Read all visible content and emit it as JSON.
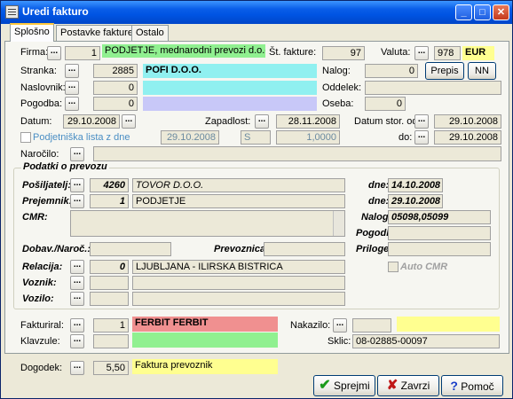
{
  "window": {
    "title": "Uredi fakturo"
  },
  "tabs": [
    "Splošno",
    "Postavke fakture",
    "Ostalo"
  ],
  "colors": {
    "green": "#90f090",
    "cyan": "#90f0f0",
    "lavender": "#c8c8f8",
    "red": "#f09090",
    "yellow": "#ffff90"
  },
  "form": {
    "firma_label": "Firma:",
    "firma_code": "1",
    "firma_name": "PODJETJE, mednarodni prevozi d.o.o.",
    "st_fakture_label": "Št. fakture:",
    "st_fakture": "97",
    "valuta_label": "Valuta:",
    "valuta_code": "978",
    "valuta_name": "EUR",
    "stranka_label": "Stranka:",
    "stranka_code": "2885",
    "stranka_name": "POFI D.O.O.",
    "naslovnik_label": "Naslovnik:",
    "naslovnik_code": "0",
    "pogodba_label": "Pogodba:",
    "pogodba_code": "0",
    "nalog_label": "Nalog:",
    "nalog": "0",
    "prepis_label": "Prepis",
    "nn_label": "NN",
    "oddelek_label": "Oddelek:",
    "oseba_label": "Oseba:",
    "oseba": "0",
    "datum_label": "Datum:",
    "datum": "29.10.2008",
    "zapadlost_label": "Zapadlost:",
    "zapadlost": "28.11.2008",
    "datum_stor_label": "Datum stor. od:",
    "datum_stor": "29.10.2008",
    "do_label": "do:",
    "do": "29.10.2008",
    "podjetniska_label": "Podjetniška lista z dne",
    "podjetniska_date": "29.10.2008",
    "podjetniska_s": "S",
    "podjetniska_rate": "1,0000",
    "narocilo_label": "Naročilo:"
  },
  "prevoz": {
    "group_title": "Podatki o prevozu",
    "posiljatelj_label": "Pošiljatelj:",
    "posiljatelj_code": "4260",
    "posiljatelj_name": "TOVOR D.O.O.",
    "prejemnik_label": "Prejemnik:",
    "prejemnik_code": "1",
    "prejemnik_name": "PODJETJE",
    "dne_label": "dne:",
    "dne1": "14.10.2008",
    "dne2": "29.10.2008",
    "cmr_label": "CMR:",
    "nalog_label": "Nalog:",
    "nalog": "05098,05099",
    "pogodba_label": "Pogodba:",
    "dobav_label": "Dobav./Naroč.:",
    "prevoznica_label": "Prevoznica:",
    "priloge_label": "Priloge:",
    "relacija_label": "Relacija:",
    "relacija_code": "0",
    "relacija_name": "LJUBLJANA - ILIRSKA BISTRICA",
    "auto_cmr_label": "Auto CMR",
    "voznik_label": "Voznik:",
    "vozilo_label": "Vozilo:"
  },
  "bottom": {
    "fakturiral_label": "Fakturiral:",
    "fakturiral_code": "1",
    "fakturiral_name": "FERBIT FERBIT",
    "nakazilo_label": "Nakazilo:",
    "klavzule_label": "Klavzule:",
    "sklic_label": "Sklic:",
    "sklic": "08-02885-00097",
    "dogodek_label": "Dogodek:",
    "dogodek_code": "5,50",
    "dogodek_name": "Faktura prevoznik",
    "ok_label": "Sprejmi",
    "cancel_label": "Zavrzi",
    "help_label": "Pomoč"
  }
}
